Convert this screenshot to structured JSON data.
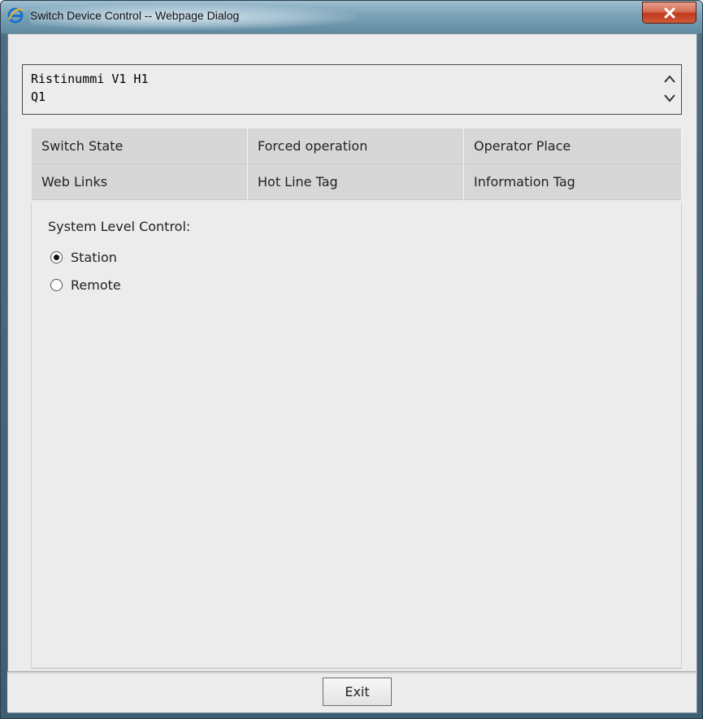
{
  "window": {
    "title": "Switch Device Control -- Webpage Dialog",
    "close_icon": "close-x-icon",
    "app_icon": "internet-explorer-icon"
  },
  "header": {
    "line1": "Ristinummi V1 H1",
    "line2": "Q1"
  },
  "tabs": [
    {
      "label": "Switch State"
    },
    {
      "label": "Forced operation"
    },
    {
      "label": "Operator Place"
    },
    {
      "label": "Web Links"
    },
    {
      "label": "Hot Line Tag"
    },
    {
      "label": "Information Tag"
    }
  ],
  "panel": {
    "label": "System Level Control:",
    "options": [
      {
        "label": "Station",
        "selected": true
      },
      {
        "label": "Remote",
        "selected": false
      }
    ]
  },
  "footer": {
    "exit_label": "Exit"
  },
  "colors": {
    "titlebar": "#7ea4b9",
    "close_button": "#c0391c",
    "tab_background": "#d7d7d7",
    "panel_background": "#ececec"
  }
}
